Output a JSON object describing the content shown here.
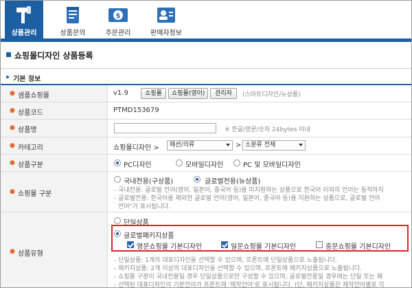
{
  "nav": {
    "tabs": [
      {
        "label": "상품관리",
        "icon": "hammer-icon",
        "active": true
      },
      {
        "label": "상품문의",
        "icon": "memo-icon",
        "active": false
      },
      {
        "label": "주문관리",
        "icon": "money-icon",
        "active": false
      },
      {
        "label": "판매자정보",
        "icon": "id-card-icon",
        "active": false
      }
    ]
  },
  "page": {
    "title": "쇼핑몰디자인 상품등록"
  },
  "section": {
    "title": "기본 정보"
  },
  "form": {
    "sample_mall": {
      "label": "샘플쇼핑몰",
      "version": "v1.9",
      "buttons": [
        "쇼핑몰",
        "쇼핑몰(영어)",
        "관리자"
      ],
      "hint": "(스마트디자인/뉴상품)"
    },
    "product_code": {
      "label": "상품코드",
      "value": "PTMD153679"
    },
    "product_name": {
      "label": "상품명",
      "value": "",
      "hint": "※ 한글/영문/숫자 24bytes 이내"
    },
    "category": {
      "label": "카테고리",
      "root": "쇼핑몰디자인 >",
      "sel1": "패션/의류",
      "sep": ">",
      "sel2": "소분류 전체"
    },
    "product_type": {
      "label": "상품구분",
      "options": [
        "PC디자인",
        "모바일디자인",
        "PC 및 모바일디자인"
      ],
      "selected": 0
    },
    "mall_type": {
      "label": "쇼핑몰 구분",
      "options": [
        "국내전용(구상품)",
        "글로벌전용(뉴상품)"
      ],
      "selected": 1,
      "notes": [
        "- 국내전용: 글로벌 언어(영어, 일본어, 중국어 등)를 미지원하는 상품으로 한국어 이외의 언어는 동작하지",
        "- 글로벌전용: 한국어를 제외한 글로벌 언어(영어, 일본어, 중국어 등)를 지원하는 상품으로, 글로벌 언어",
        "언어\"가 표시됩니다."
      ]
    },
    "goods_type": {
      "label": "상품유형",
      "single": "단일상품",
      "package": "글로벌패키지상품",
      "selected": "package",
      "checks": [
        {
          "label": "영문쇼핑몰 기본디자인",
          "checked": true
        },
        {
          "label": "일문쇼핑몰 기본디자인",
          "checked": true
        },
        {
          "label": "중문쇼핑몰 기본디자인",
          "checked": false
        }
      ],
      "notes": [
        "- 단일상품: 1개의 대표디자인을 선택할 수 있으며, 프론트에 단일상품으로 노출됩니다.",
        "- 패키지상품: 2개 이상의 대표디자인을 선택할 수 있으며, 프론트에 패키지상품으로 노출됩니다.",
        "- 쇼핑몰 구분이 국내전용일 경우 단일상품으로만 구성할 수 있으며, 글로벌전용일 경우에는 단일 또는 패",
        "- 선택된 대표디자인의 기본언어가 프론트에 '제작언어'로 표시됩니다. (단, 패키지상품은 제작언어별로 각"
      ]
    }
  },
  "colors": {
    "brand": "#1d5fa3",
    "highlight": "#d6262b",
    "required": "#e36b2e"
  }
}
